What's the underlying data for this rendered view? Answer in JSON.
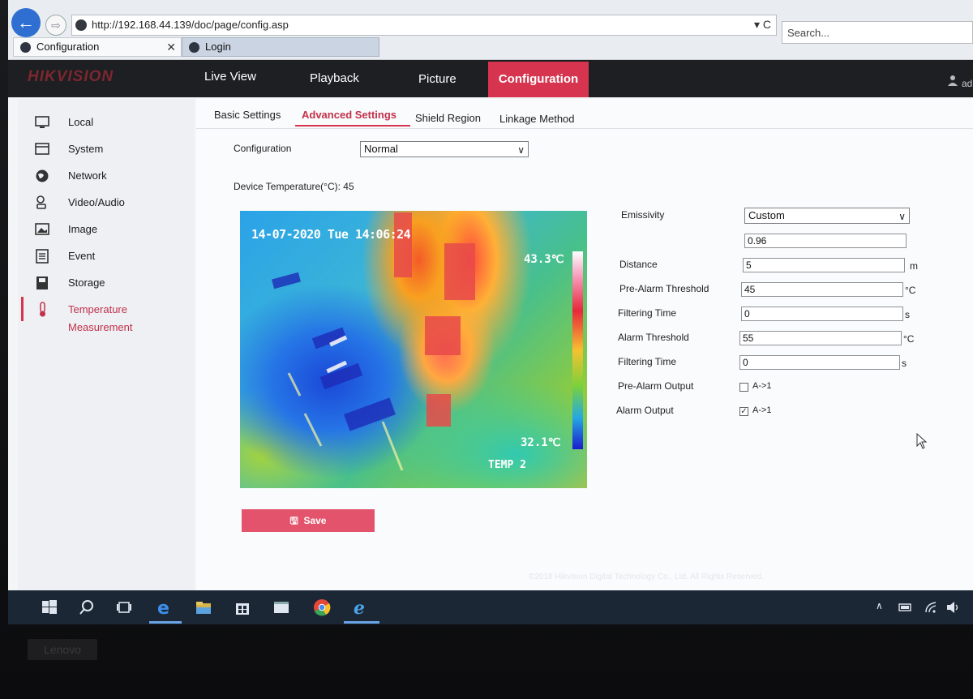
{
  "browser": {
    "url": "http://192.168.44.139/doc/page/config.asp",
    "address_controls": "▾ C",
    "search_placeholder": "Search...",
    "tabs": [
      {
        "label": "Configuration",
        "close": "✕"
      },
      {
        "label": "Login"
      }
    ]
  },
  "app": {
    "logo": "HIKVISION",
    "nav": [
      "Live View",
      "Playback",
      "Picture",
      "Configuration"
    ],
    "active_nav": "Configuration",
    "user_text": "ad"
  },
  "sidebar": {
    "items": [
      {
        "label": "Local",
        "icon": "monitor-icon"
      },
      {
        "label": "System",
        "icon": "system-icon"
      },
      {
        "label": "Network",
        "icon": "globe-icon"
      },
      {
        "label": "Video/Audio",
        "icon": "microphone-icon"
      },
      {
        "label": "Image",
        "icon": "image-icon"
      },
      {
        "label": "Event",
        "icon": "event-list-icon"
      },
      {
        "label": "Storage",
        "icon": "storage-icon"
      },
      {
        "label": "Temperature Measurement",
        "icon": "thermometer-icon"
      }
    ],
    "active": "Temperature Measurement"
  },
  "subtabs": [
    "Basic Settings",
    "Advanced Settings",
    "Shield Region",
    "Linkage Method"
  ],
  "active_subtab": "Advanced Settings",
  "config": {
    "label": "Configuration",
    "value": "Normal"
  },
  "device_temperature": "Device Temperature(°C): 45",
  "thermal": {
    "osd_date": "14-07-2020 Tue 14:06:24",
    "max_temp": "43.3℃",
    "min_temp": "32.1℃",
    "mode_label": "TEMP 2"
  },
  "settings": {
    "emissivity": {
      "label": "Emissivity",
      "value": "Custom",
      "custom_value": "0.96"
    },
    "distance": {
      "label": "Distance",
      "value": "5",
      "unit": "m"
    },
    "pre_alarm_threshold": {
      "label": "Pre-Alarm Threshold",
      "value": "45",
      "unit": "°C"
    },
    "filtering_time_1": {
      "label": "Filtering Time",
      "value": "0",
      "unit": "s"
    },
    "alarm_threshold": {
      "label": "Alarm Threshold",
      "value": "55",
      "unit": "°C"
    },
    "filtering_time_2": {
      "label": "Filtering Time",
      "value": "0",
      "unit": "s"
    },
    "pre_alarm_output": {
      "label": "Pre-Alarm Output",
      "option": "A->1",
      "checked": false
    },
    "alarm_output": {
      "label": "Alarm Output",
      "option": "A->1",
      "checked": true
    }
  },
  "save_label": "Save",
  "footer": "©2018 Hikvision Digital Technology Co., Ltd. All Rights Reserved.",
  "bezel_brand": "Lenovo",
  "colors": {
    "accent": "#d6344f",
    "header": "#1d1f22",
    "taskbar": "#1c2736"
  }
}
